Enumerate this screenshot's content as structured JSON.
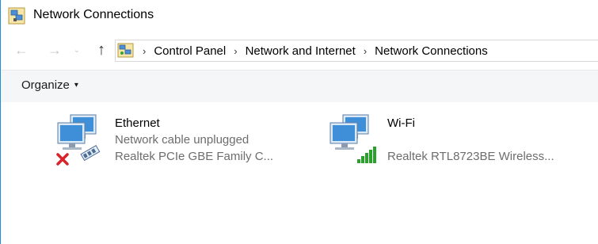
{
  "window": {
    "title": "Network Connections"
  },
  "nav": {
    "back_glyph": "←",
    "forward_glyph": "→",
    "recent_glyph": "⌄",
    "up_glyph": "↑"
  },
  "breadcrumb": {
    "separator": "›",
    "items": [
      "Control Panel",
      "Network and Internet",
      "Network Connections"
    ]
  },
  "toolbar": {
    "organize_label": "Organize",
    "organize_caret": "▾"
  },
  "connections": [
    {
      "name": "Ethernet",
      "status": "Network cable unplugged",
      "device": "Realtek PCIe GBE Family C...",
      "icon": "ethernet-disconnected-icon"
    },
    {
      "name": "Wi-Fi",
      "status": "",
      "device": "Realtek RTL8723BE Wireless...",
      "icon": "wifi-adapter-icon"
    }
  ],
  "colors": {
    "accent_border": "#1E90D9",
    "toolbar_bg": "#f5f6f7",
    "status_text": "#6d6d6d",
    "error_red": "#d9232a",
    "signal_green": "#2aa12a"
  }
}
